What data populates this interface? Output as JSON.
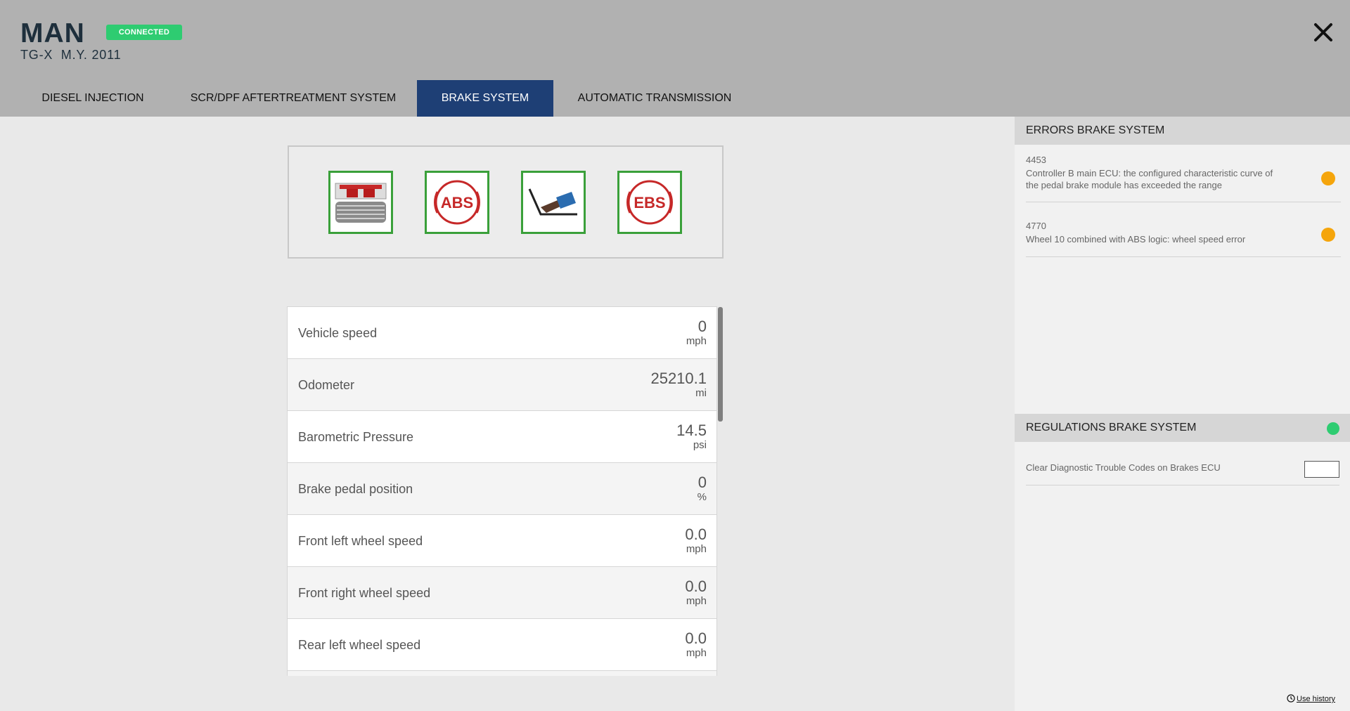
{
  "header": {
    "brand": "MAN",
    "status": "CONNECTED",
    "model": "TG-X  M.Y. 2011",
    "close_icon": "close-icon"
  },
  "tabs": [
    {
      "label": "DIESEL INJECTION",
      "active": false
    },
    {
      "label": "SCR/DPF AFTERTREATMENT SYSTEM",
      "active": false
    },
    {
      "label": "BRAKE SYSTEM",
      "active": true
    },
    {
      "label": "AUTOMATIC TRANSMISSION",
      "active": false
    }
  ],
  "icon_panel": {
    "icons": [
      {
        "name": "brake-lining-icon"
      },
      {
        "name": "abs-icon",
        "text": "ABS"
      },
      {
        "name": "brake-pedal-icon"
      },
      {
        "name": "ebs-icon",
        "text": "EBS"
      }
    ]
  },
  "parameters": [
    {
      "label": "Vehicle speed",
      "value": "0",
      "unit": "mph"
    },
    {
      "label": "Odometer",
      "value": "25210.1",
      "unit": "mi"
    },
    {
      "label": "Barometric Pressure",
      "value": "14.5",
      "unit": "psi"
    },
    {
      "label": "Brake pedal position",
      "value": "0",
      "unit": "%"
    },
    {
      "label": "Front left wheel speed",
      "value": "0.0",
      "unit": "mph"
    },
    {
      "label": "Front right wheel speed",
      "value": "0.0",
      "unit": "mph"
    },
    {
      "label": "Rear left wheel speed",
      "value": "0.0",
      "unit": "mph"
    }
  ],
  "errors": {
    "title": "ERRORS BRAKE SYSTEM",
    "items": [
      {
        "code": "4453",
        "description": "Controller B main ECU: the configured characteristic curve of the pedal brake module has exceeded the range",
        "status_color": "#f5a50c"
      },
      {
        "code": "4770",
        "description": "Wheel 10 combined with ABS logic: wheel speed error",
        "status_color": "#f5a50c"
      }
    ]
  },
  "regulations": {
    "title": "REGULATIONS BRAKE SYSTEM",
    "status_color": "#2ecc71",
    "items": [
      {
        "label": "Clear Diagnostic Trouble Codes on Brakes ECU"
      }
    ]
  },
  "footer": {
    "history_label": "Use history"
  },
  "colors": {
    "header_bg": "#b1b1b1",
    "active_tab": "#1e3f75",
    "connected": "#2ecc71",
    "tile_border": "#3aa03a",
    "warning": "#f5a50c"
  }
}
